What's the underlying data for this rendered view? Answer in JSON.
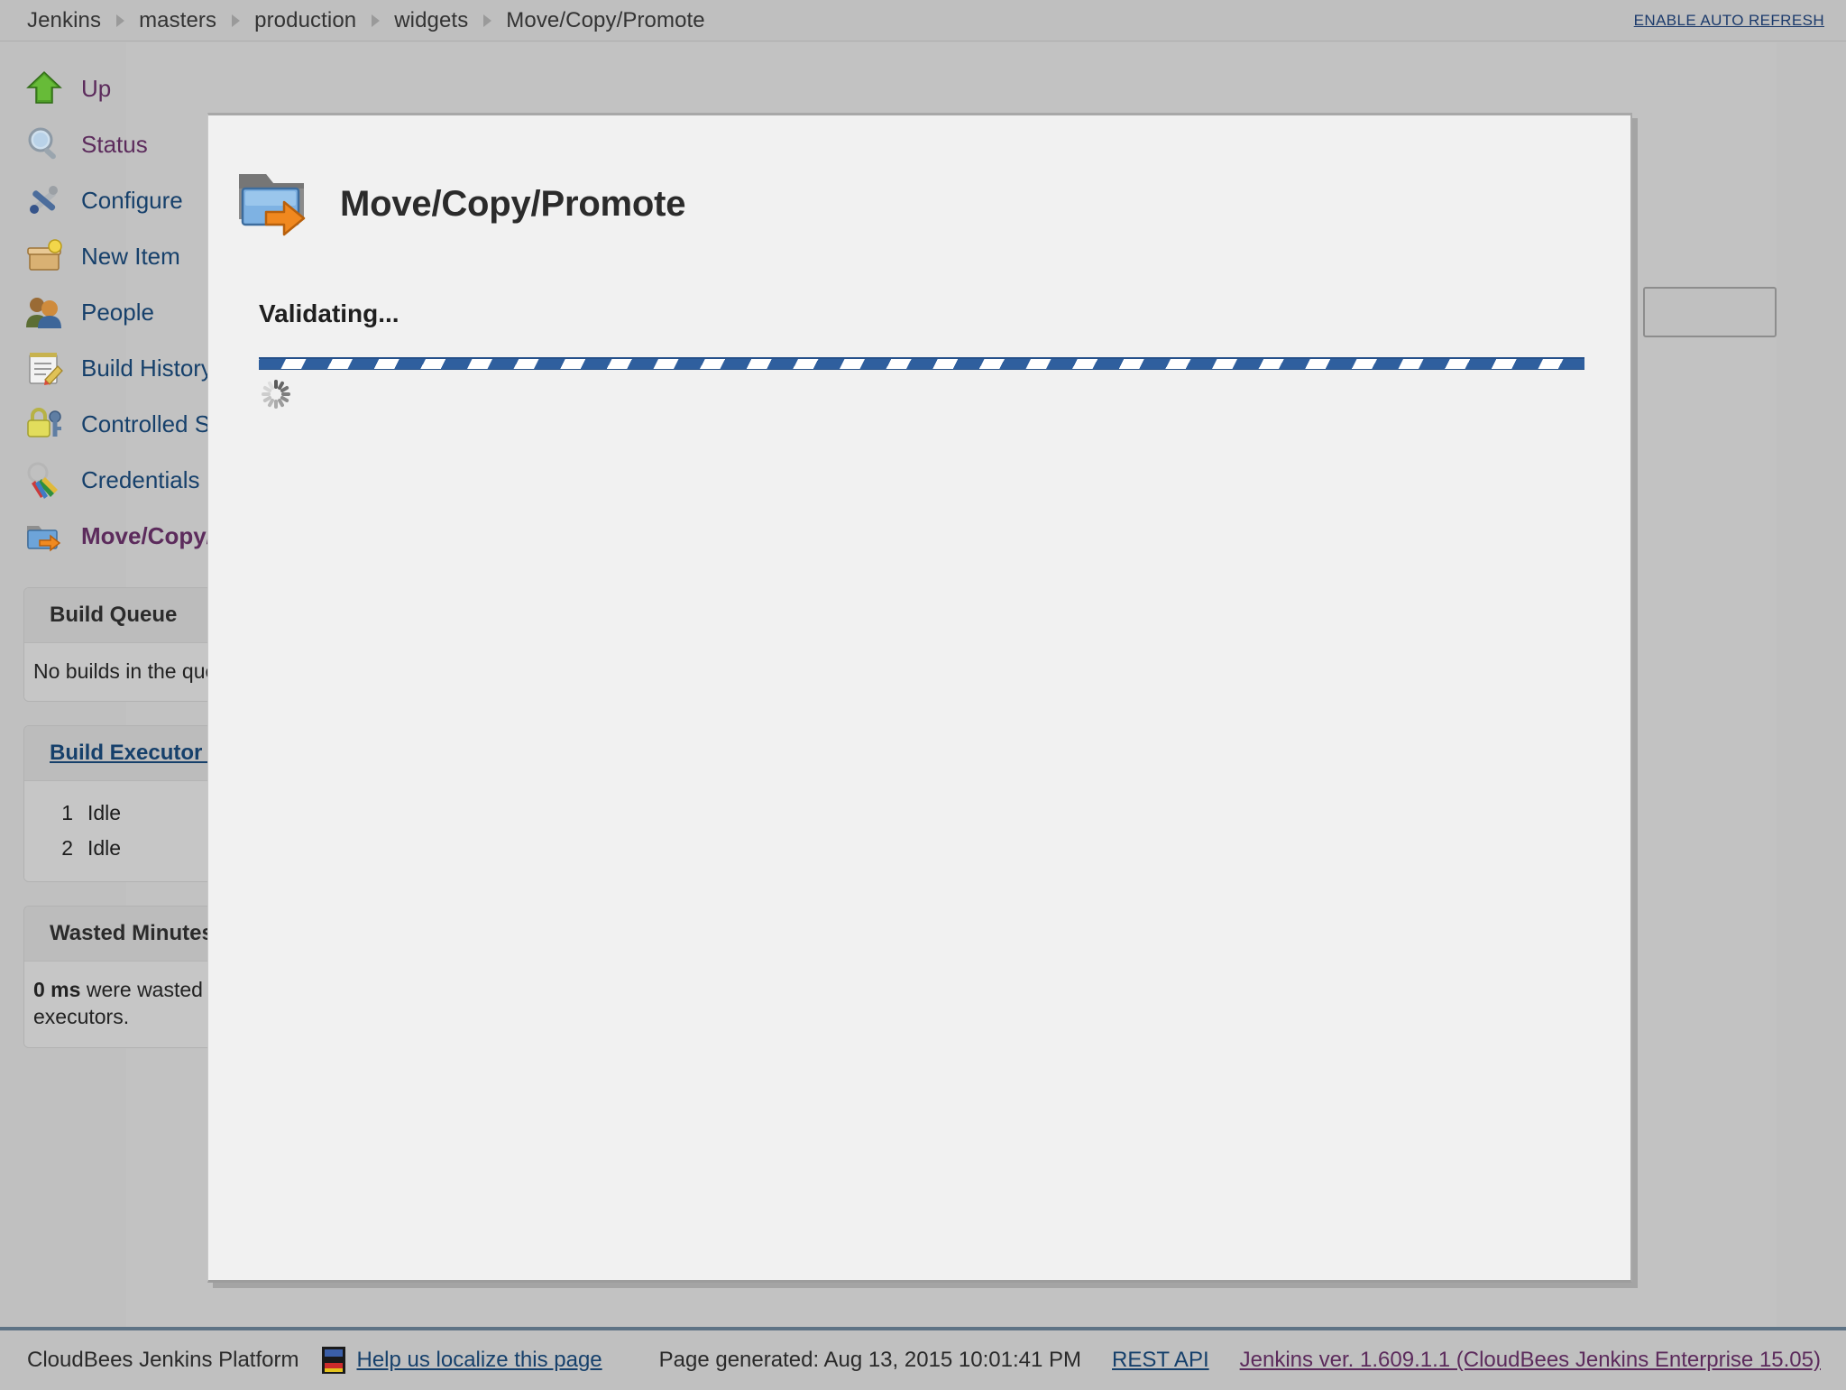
{
  "breadcrumb": {
    "items": [
      "Jenkins",
      "masters",
      "production",
      "widgets",
      "Move/Copy/Promote"
    ],
    "auto_refresh_label": "ENABLE AUTO REFRESH"
  },
  "sidebar": {
    "items": [
      {
        "label": "Up",
        "icon": "up-arrow-icon",
        "state": "visited"
      },
      {
        "label": "Status",
        "icon": "magnifier-icon",
        "state": "visited"
      },
      {
        "label": "Configure",
        "icon": "tools-icon",
        "state": "link"
      },
      {
        "label": "New Item",
        "icon": "new-item-icon",
        "state": "link"
      },
      {
        "label": "People",
        "icon": "people-icon",
        "state": "link"
      },
      {
        "label": "Build History",
        "icon": "notebook-icon",
        "state": "link"
      },
      {
        "label": "Controlled Slaves",
        "icon": "lock-key-icon",
        "state": "link"
      },
      {
        "label": "Credentials",
        "icon": "keys-icon",
        "state": "link"
      },
      {
        "label": "Move/Copy/Promote",
        "icon": "folder-move-icon",
        "state": "active"
      }
    ],
    "build_queue": {
      "title": "Build Queue",
      "body": "No builds in the queue."
    },
    "build_executor_status": {
      "title": "Build Executor Status",
      "executors": [
        {
          "num": "1",
          "status": "Idle"
        },
        {
          "num": "2",
          "status": "Idle"
        }
      ]
    },
    "wasted_minutes": {
      "title": "Wasted Minutes",
      "value": "0 ms",
      "body_rest": " were wasted waiting for executors.",
      "body_line2": "executors."
    }
  },
  "modal": {
    "icon": "folder-move-icon",
    "title": "Move/Copy/Promote",
    "status_text": "Validating...",
    "progress": {
      "type": "indeterminate",
      "bar_color": "#2f5f9e",
      "stripe_color": "#ffffff"
    },
    "spinner_icon": "loading-spinner-icon"
  },
  "footer": {
    "product": "CloudBees Jenkins Platform",
    "localize_icon": "flag-icon",
    "localize_link": "Help us localize this page",
    "page_generated": "Page generated: Aug 13, 2015 10:01:41 PM",
    "rest_api": "REST API",
    "version": "Jenkins ver. 1.609.1.1 (CloudBees Jenkins Enterprise 15.05)"
  },
  "colors": {
    "page_bg": "#c0c0c0",
    "modal_bg": "#f1f1f1",
    "link": "#16406b",
    "visited_link": "#5c2b5c",
    "accent_blue": "#2f5f9e",
    "footer_divider": "#5e7385"
  }
}
